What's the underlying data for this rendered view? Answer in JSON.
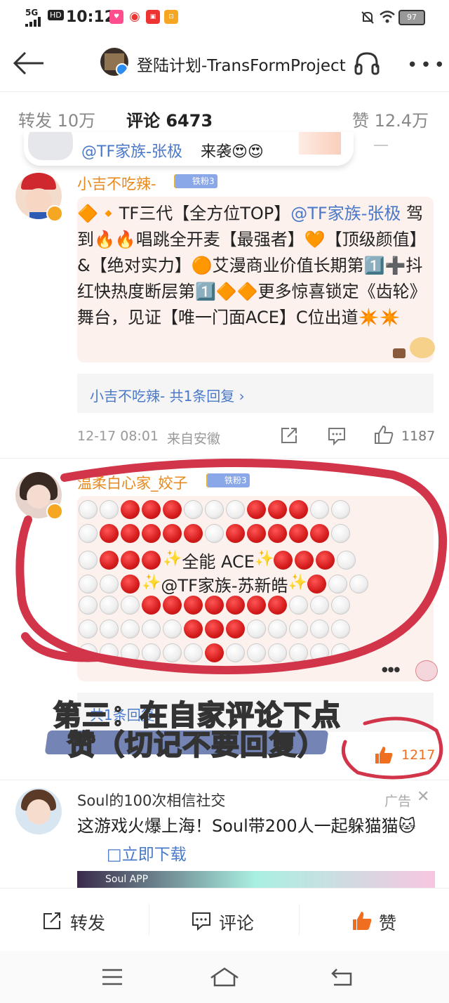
{
  "status": {
    "signal": "5G",
    "time": "10:12",
    "hd": "HD",
    "battery": "97"
  },
  "nav": {
    "title": "登陆计划-TransFormProject"
  },
  "tabs": [
    {
      "label": "转发 10万"
    },
    {
      "label": "评论 6473"
    },
    {
      "label": "赞 12.4万"
    }
  ],
  "float_card": {
    "mention": "@TF家族-张极",
    "text": "来袭😍😍"
  },
  "comment1": {
    "user": "小吉不吃辣-",
    "badge": "铁粉3",
    "text_a": "🔶🔸TF三代【全方位TOP】",
    "mention": "@TF家族-张极",
    "text_b": " 驾到🔥🔥唱跳全开麦【最强者】🧡【顶级颜值】&【绝对实力】🟠艾漫商业价值长期第1️⃣➕抖红快热度断层第1️⃣🔶🔶更多惊喜锁定《齿轮》舞台，见证【唯一门面ACE】C位出道✴️✴️",
    "reply_text": "小吉不吃辣-  共1条回复 ›",
    "time": "12-17 08:01",
    "location": "来自安徽",
    "likes": "1187"
  },
  "comment2": {
    "user": "温柔白心家_姣子",
    "badge": "铁粉3",
    "line3_text": "全能 ACE",
    "line4_mention": "@TF家族-苏新皓",
    "reply_text": "共1条回复",
    "likes": "1217"
  },
  "overlay_caption": {
    "line1": "第三：在自家评论下点",
    "line2": "赞（切记不要回复）"
  },
  "ad": {
    "user": "Soul的100次相信社交",
    "tag": "广告",
    "text": "这游戏火爆上海！Soul带200人一起躲猫猫🐱",
    "link": "□立即下载",
    "banner_label": "Soul APP"
  },
  "bottom": {
    "repost": "转发",
    "comment": "评论",
    "like": "赞"
  },
  "colors": {
    "accent": "#e8891d",
    "link": "#4a79c9",
    "like": "#f06e1f",
    "circle": "#d2354a"
  }
}
